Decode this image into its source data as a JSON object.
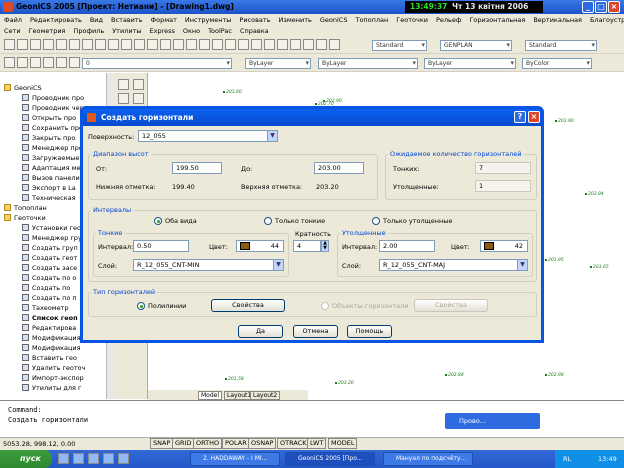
{
  "window": {
    "title": "GeoniCS 2005 [Проект: Нетиани] - [Drawing1.dwg]",
    "clock_time": "13:49:37",
    "clock_date": "Чт 13 квітня 2006",
    "min": "_",
    "max": "□",
    "close": "×"
  },
  "menu1": [
    "Файл",
    "Редактировать",
    "Вид",
    "Вставить",
    "Формат",
    "Инструменты",
    "Рисовать",
    "Изменить",
    "GeoniCS",
    "Топоплан",
    "Геоточки",
    "Рельеф",
    "Горизонтальная",
    "Вертикальная",
    "Благоустройство"
  ],
  "menu2": [
    "Сети",
    "Геометрия",
    "Профиль",
    "Утилиты",
    "Express",
    "Окно",
    "ToolPac",
    "Справка"
  ],
  "toolbar": {
    "style1": "Standard",
    "dimstyle": "GENPLAN",
    "style2": "Standard",
    "layer": "0",
    "color": "ByLayer",
    "linetype": "ByLayer",
    "lineweight": "ByLayer",
    "plotstyle": "ByColor"
  },
  "tree": [
    {
      "text": "GeoniCS",
      "type": "folder"
    },
    {
      "text": "Проводник про",
      "type": "item"
    },
    {
      "text": "Проводник чер",
      "type": "item"
    },
    {
      "text": "Открыть про",
      "type": "item"
    },
    {
      "text": "Сохранить проект",
      "type": "item"
    },
    {
      "text": "Закрыть про",
      "type": "item"
    },
    {
      "text": "Менеджер про",
      "type": "item"
    },
    {
      "text": "Загружаемые",
      "type": "item"
    },
    {
      "text": "Адаптация ме",
      "type": "item"
    },
    {
      "text": "Вызов панели",
      "type": "item"
    },
    {
      "text": "Экспорт в La",
      "type": "item"
    },
    {
      "text": "Техническая",
      "type": "item"
    },
    {
      "text": "Топоплан",
      "type": "folder"
    },
    {
      "text": "Геоточки",
      "type": "folder"
    },
    {
      "text": "Установки гео",
      "type": "item"
    },
    {
      "text": "Менеджер гру",
      "type": "item"
    },
    {
      "text": "Создать груп",
      "type": "item"
    },
    {
      "text": "Создать геот",
      "type": "item"
    },
    {
      "text": "Создать засе",
      "type": "item"
    },
    {
      "text": "Создать по о",
      "type": "item"
    },
    {
      "text": "Создать по",
      "type": "item"
    },
    {
      "text": "Создать по п",
      "type": "item"
    },
    {
      "text": "Тахеометр",
      "type": "item"
    },
    {
      "text": "Список геоп",
      "type": "item",
      "bold": true
    },
    {
      "text": "Редактирова",
      "type": "item"
    },
    {
      "text": "Модификация",
      "type": "item"
    },
    {
      "text": "Модификация",
      "type": "item"
    },
    {
      "text": "Вставить гео",
      "type": "item"
    },
    {
      "text": "Удалить геоточ",
      "type": "item"
    },
    {
      "text": "Импорт-экспор",
      "type": "item"
    },
    {
      "text": "Утилиты для г",
      "type": "item"
    }
  ],
  "points": [
    "203.60",
    "202.90",
    "202.70",
    "201.70",
    "201.60",
    "203.50",
    "203.14",
    "203.90",
    "202.88",
    "202.60",
    "202.34",
    "203.94",
    "203.65",
    "201.95",
    "201.70",
    "201.58",
    "203.20",
    "202.84",
    "202.98"
  ],
  "layout_tabs": [
    "Model",
    "Layout1",
    "Layout2"
  ],
  "command": {
    "line1": "Command:",
    "line2": "Создать горизонтали"
  },
  "coords": "5053.28, 998.12, 0.00",
  "status_buttons": [
    "SNAP",
    "GRID",
    "ORTHO",
    "POLAR",
    "OSNAP",
    "OTRACK",
    "LWT",
    "MODEL"
  ],
  "mini_window": "Прово...",
  "taskbar": {
    "start": "пуск",
    "tasks": [
      "2. HADDAWAY - I MI...",
      "GeoniCS 2005 [Про...",
      "Мануал по подсчёту..."
    ],
    "lang": "RL",
    "time": "13:49"
  },
  "dialog": {
    "title": "Создать горизонтали",
    "surface_label": "Поверхность:",
    "surface_value": "12_055",
    "range_group": "Диапазон высот",
    "from_label": "От:",
    "from_value": "199.50",
    "to_label": "До:",
    "to_value": "203.00",
    "low_label": "Нижняя отметка:",
    "low_value": "199.40",
    "high_label": "Верхняя отметка:",
    "high_value": "203.20",
    "expected_group": "Ожидаемое количество горизонталей",
    "thin_label": "Тонких:",
    "thin_value": "7",
    "thick_label": "Утолщенные:",
    "thick_value": "1",
    "intervals_group": "Интервалы",
    "radio_both": "Оба вида",
    "radio_thin": "Только тонкие",
    "radio_thick": "Только утолщенные",
    "thin_group": "Тонкие",
    "thin_interval_label": "Интервал:",
    "thin_interval_value": "0.50",
    "thin_color_label": "Цвет:",
    "thin_color_value": "44",
    "thin_layer_label": "Слой:",
    "thin_layer_value": "R_12_055_CNT-MIN",
    "multiplicity_label": "Кратность",
    "multiplicity_value": "4",
    "thick_group": "Утолщенные",
    "thick_interval_label": "Интервал:",
    "thick_interval_value": "2.00",
    "thick_color_label": "Цвет:",
    "thick_color_value": "42",
    "thick_layer_label": "Слой:",
    "thick_layer_value": "R_12_055_CNT-MAJ",
    "type_group": "Тип горизонталей",
    "radio_polyline": "Полилинии",
    "props1": "Свойства",
    "radio_objects": "Объекты-горизонтали",
    "props2": "Свойства",
    "ok": "Да",
    "cancel": "Отмена",
    "help": "Помощь",
    "help_icon": "?",
    "close_icon": "×",
    "thin_color_hex": "#8a5a12",
    "thick_color_hex": "#8a5a12"
  }
}
